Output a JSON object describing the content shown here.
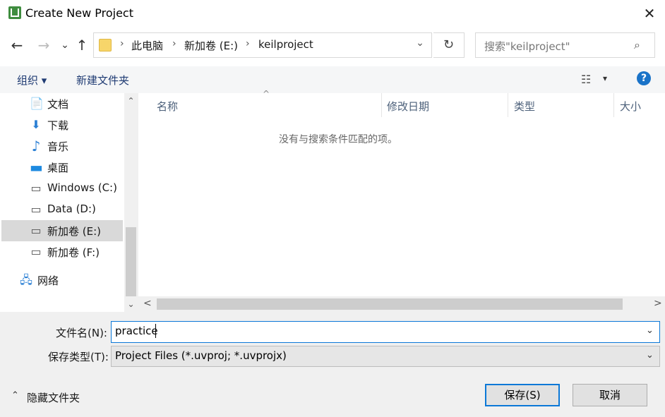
{
  "window": {
    "title": "Create New Project",
    "close_glyph": "✕"
  },
  "nav": {
    "back_glyph": "←",
    "forward_glyph": "→",
    "recent_glyph": "⌄",
    "up_glyph": "↑"
  },
  "address": {
    "crumbs": [
      "此电脑",
      "新加卷 (E:)",
      "keilproject"
    ],
    "separator": "›",
    "dropdown_glyph": "⌄",
    "refresh_glyph": "↻"
  },
  "search": {
    "placeholder": "搜索\"keilproject\"",
    "icon_glyph": "⌕"
  },
  "toolbar": {
    "organize": "组织 ▾",
    "new_folder": "新建文件夹",
    "view_glyph": "☷",
    "view_dd_glyph": "▾",
    "help_glyph": "?"
  },
  "sidebar": {
    "items": [
      {
        "label": "文档",
        "icon": "document-icon",
        "glyph": "📄",
        "selected": false
      },
      {
        "label": "下载",
        "icon": "download-icon",
        "glyph": "⬇",
        "selected": false
      },
      {
        "label": "音乐",
        "icon": "music-icon",
        "glyph": "♪",
        "selected": false
      },
      {
        "label": "桌面",
        "icon": "desktop-icon",
        "glyph": "▬",
        "selected": false
      },
      {
        "label": "Windows (C:)",
        "icon": "drive-icon",
        "glyph": "▭",
        "selected": false
      },
      {
        "label": "Data (D:)",
        "icon": "drive-icon",
        "glyph": "▭",
        "selected": false
      },
      {
        "label": "新加卷 (E:)",
        "icon": "drive-icon",
        "glyph": "▭",
        "selected": true
      },
      {
        "label": "新加卷 (F:)",
        "icon": "drive-icon",
        "glyph": "▭",
        "selected": false
      },
      {
        "label": "网络",
        "icon": "network-icon",
        "glyph": "🖧",
        "selected": false
      }
    ],
    "scroll_up_glyph": "⌃",
    "scroll_down_glyph": "⌄"
  },
  "content": {
    "columns": [
      "名称",
      "修改日期",
      "类型",
      "大小"
    ],
    "sort_glyph": "^",
    "empty_message": "没有与搜索条件匹配的项。",
    "hscroll_left": "<",
    "hscroll_right": ">"
  },
  "form": {
    "filename_label": "文件名(N):",
    "filename_value": "practice",
    "filetype_label": "保存类型(T):",
    "filetype_value": "Project Files (*.uvproj; *.uvprojx)",
    "dropdown_glyph": "⌄"
  },
  "footer": {
    "hide_toggle_glyph": "⌃",
    "hide_folders": "隐藏文件夹",
    "save_button": "保存(S)",
    "cancel_button": "取消"
  }
}
